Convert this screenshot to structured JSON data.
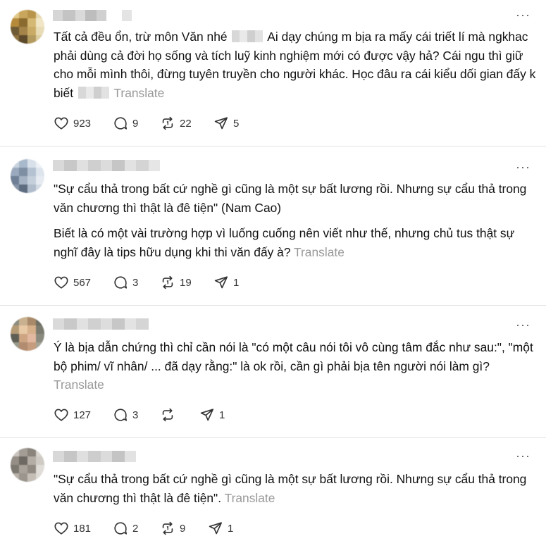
{
  "translate_label": "Translate",
  "posts": [
    {
      "paragraphs": [
        [
          "Tất cả đều ổn, trừ môn Văn nhé ",
          " Ai dạy chúng m bịa ra mấy cái triết lí mà ngkhac phải dùng cả đời họ sống và tích luỹ kinh nghiệm mới có được vậy hả? Cái ngu thì giữ cho mỗi mình thôi, đừng tuyên truyền cho người khác. Học đâu ra cái kiểu dối gian đấy k biết"
        ]
      ],
      "likes": "923",
      "replies": "9",
      "reposts": "22",
      "shares": "5"
    },
    {
      "paragraphs": [
        [
          "\"Sự cẩu thả trong bất cứ nghề gì cũng là một sự bất lương rồi. Nhưng sự cẩu thả trong văn chương thì thật là đê tiện\" (Nam Cao)"
        ],
        [
          "Biết là có một vài trường hợp vì luống cuống nên viết như thế, nhưng chủ tus thật sự nghĩ đây là tips hữu dụng khi thi văn đấy à?"
        ]
      ],
      "likes": "567",
      "replies": "3",
      "reposts": "19",
      "shares": "1"
    },
    {
      "paragraphs": [
        [
          "Ý là bịa dẫn chứng thì chỉ cần nói là \"có một câu nói tôi vô cùng tâm đắc như sau:\", \"một bộ phim/ vĩ nhân/ ... đã dạy rằng:\" là ok rồi, cần gì phải bịa tên người nói làm gì?"
        ]
      ],
      "likes": "127",
      "replies": "3",
      "reposts": "",
      "shares": "1"
    },
    {
      "paragraphs": [
        [
          "\"Sự cẩu thả trong bất cứ nghề gì cũng là một sự bất lương rồi. Nhưng sự cẩu thả trong văn chương thì thật là đê tiện\"."
        ]
      ],
      "likes": "181",
      "replies": "2",
      "reposts": "9",
      "shares": "1"
    }
  ]
}
